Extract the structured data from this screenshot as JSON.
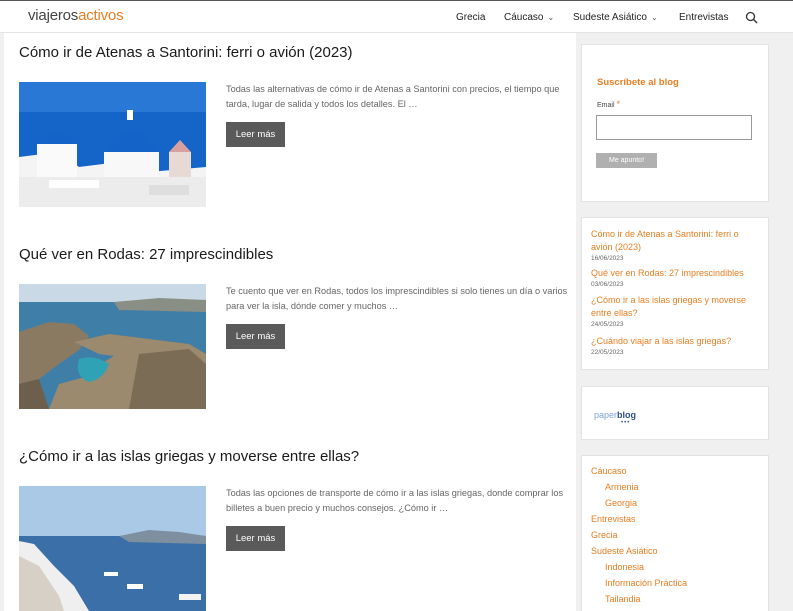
{
  "header": {
    "logo_part1": "viajeros",
    "logo_part2": "activos",
    "nav": [
      {
        "label": "Grecia",
        "chevron": false
      },
      {
        "label": "Cáucaso",
        "chevron": true
      },
      {
        "label": "Sudeste Asiático",
        "chevron": true
      },
      {
        "label": "Entrevistas",
        "chevron": false
      }
    ],
    "search_icon": "search-icon"
  },
  "posts": [
    {
      "title": "Cómo ir de Atenas a Santorini: ferri o avión (2023)",
      "excerpt": "Todas las alternativas de cómo ir de Atenas a Santorini con precios, el tiempo que tarda, lugar de salida y todos los detalles. El …",
      "button": "Leer más"
    },
    {
      "title": "Qué ver en Rodas: 27 imprescindibles",
      "excerpt": "Te cuento que ver en Rodas, todos los imprescindibles si solo tienes un día o varios para ver la isla, dónde comer y muchos …",
      "button": "Leer más"
    },
    {
      "title": "¿Cómo ir a las islas griegas y moverse entre ellas?",
      "excerpt": "Todas las opciones de transporte de cómo ir a las islas griegas, donde comprar los billetes a buen precio y muchos consejos. ¿Cómo ir …",
      "button": "Leer más"
    }
  ],
  "subscribe": {
    "title": "Suscríbete al blog",
    "email_label": "Email",
    "required_mark": "*",
    "email_value": "",
    "button": "Me apunto!"
  },
  "recent": [
    {
      "title": "Cómo ir de Atenas a Santorini: ferri o avión (2023)",
      "date": "16/06/2023"
    },
    {
      "title": "Qué ver en Rodas: 27 imprescindibles",
      "date": "03/06/2023"
    },
    {
      "title": "¿Cómo ir a las islas griegas y moverse entre ellas?",
      "date": "24/05/2023"
    },
    {
      "title": "¿Cuándo viajar a las islas griegas?",
      "date": "22/05/2023"
    }
  ],
  "paperblog": {
    "part1": "paper",
    "part2": "blog"
  },
  "categories": [
    {
      "label": "Cáucaso"
    },
    {
      "label": "Armenia"
    },
    {
      "label": "Georgia"
    },
    {
      "label": "Entrevistas"
    },
    {
      "label": "Grecia"
    },
    {
      "label": "Sudeste Asiático"
    },
    {
      "label": "Indonesia"
    },
    {
      "label": "Información Práctica"
    },
    {
      "label": "Tailandia"
    }
  ],
  "colors": {
    "accent": "#e67e22",
    "button": "#5a5a5a"
  }
}
